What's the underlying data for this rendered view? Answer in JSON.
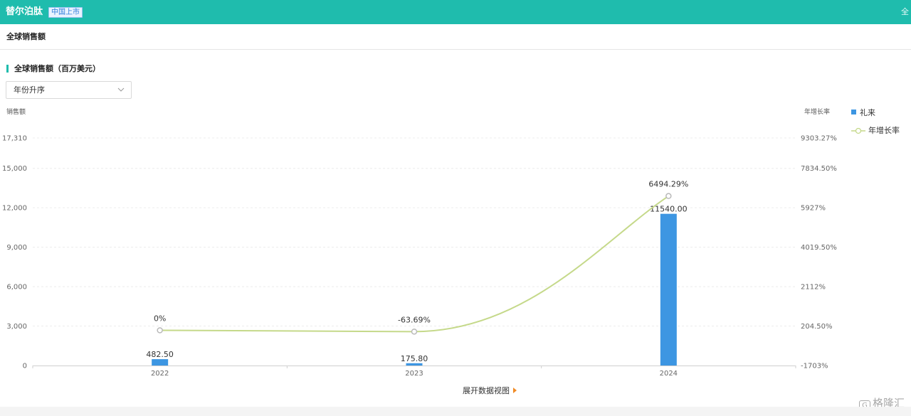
{
  "header": {
    "drug_name": "替尔泊肽",
    "market_badge": "中国上市",
    "right_text": "全"
  },
  "section": {
    "title": "全球销售额"
  },
  "chart_panel": {
    "subtitle": "全球销售额（百万美元）",
    "sort_select": {
      "value": "年份升序"
    },
    "expand_link": "展开数据视图"
  },
  "colors": {
    "header_bg": "#1fbcad",
    "bar": "#3d96e2",
    "growth_line": "#c5d98a",
    "expand_arrow": "#f08a24"
  },
  "watermark": {
    "glyph": "G",
    "text": "格隆汇"
  },
  "chart_data": {
    "type": "bar",
    "categories": [
      "2022",
      "2023",
      "2024"
    ],
    "series": [
      {
        "name": "礼来",
        "type": "bar",
        "axis": "left",
        "values": [
          482.5,
          175.8,
          11540.0
        ],
        "labels": [
          "482.50",
          "175.80",
          "11540.00"
        ]
      },
      {
        "name": "年增长率",
        "type": "line",
        "axis": "right",
        "values": [
          0,
          -63.69,
          6494.29
        ],
        "labels": [
          "0%",
          "-63.69%",
          "6494.29%"
        ]
      }
    ],
    "ylabel": "销售额",
    "y2label": "年增长率",
    "ylim": [
      0,
      17310
    ],
    "y2lim": [
      -1703,
      9303.27
    ],
    "yticks": [
      "0",
      "3,000",
      "6,000",
      "9,000",
      "12,000",
      "15,000",
      "17,310"
    ],
    "y2ticks": [
      "-1703%",
      "204.50%",
      "2112%",
      "4019.50%",
      "5927%",
      "7834.50%",
      "9303.27%"
    ],
    "grid": true,
    "legend": "right"
  }
}
